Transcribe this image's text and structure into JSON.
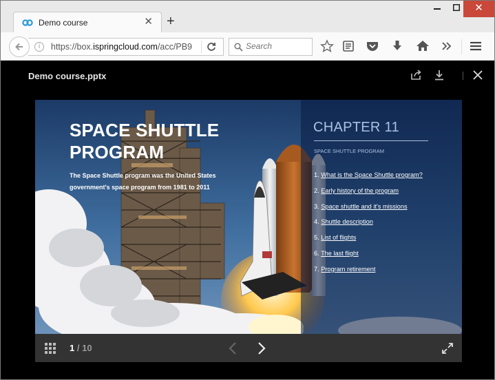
{
  "browser": {
    "tab_title": "Demo course",
    "url_prefix": "https://box.",
    "url_host": "ispringcloud.com",
    "url_path": "/acc/PB9",
    "search_placeholder": "Search"
  },
  "viewer": {
    "doc_title": "Demo course.pptx",
    "current_page": "1",
    "page_separator": "/",
    "total_pages": "10"
  },
  "slide": {
    "title": "SPACE SHUTTLE PROGRAM",
    "description": "The Space Shuttle program was the United States government's space program from 1981 to 2011",
    "chapter": "CHAPTER 11",
    "chapter_subtitle": "SPACE SHUTTLE PROGRAM",
    "toc": [
      {
        "num": "1.",
        "label": "What is the Space Shuttle program?"
      },
      {
        "num": "2.",
        "label": "Early history of the program"
      },
      {
        "num": "3.",
        "label": "Space shuttle and it's missions"
      },
      {
        "num": "4.",
        "label": "Shuttle description"
      },
      {
        "num": "5.",
        "label": "List of flights"
      },
      {
        "num": "6.",
        "label": "The last flight"
      },
      {
        "num": "7.",
        "label": "Program retirement"
      }
    ]
  },
  "colors": {
    "viewer_background": "#000000",
    "control_bar": "#333333",
    "chapter_accent": "#a9c2e2",
    "close_button": "#c9483a"
  },
  "icons": [
    "favicon-icon",
    "close-tab-icon",
    "new-tab-icon",
    "back-arrow-icon",
    "info-icon",
    "reload-icon",
    "search-icon",
    "star-icon",
    "reading-list-icon",
    "pocket-icon",
    "download-icon",
    "home-icon",
    "overflow-icon",
    "hamburger-menu-icon",
    "share-icon",
    "viewer-download-icon",
    "viewer-close-icon",
    "grid-icon",
    "prev-arrow-icon",
    "next-arrow-icon",
    "fullscreen-icon"
  ]
}
